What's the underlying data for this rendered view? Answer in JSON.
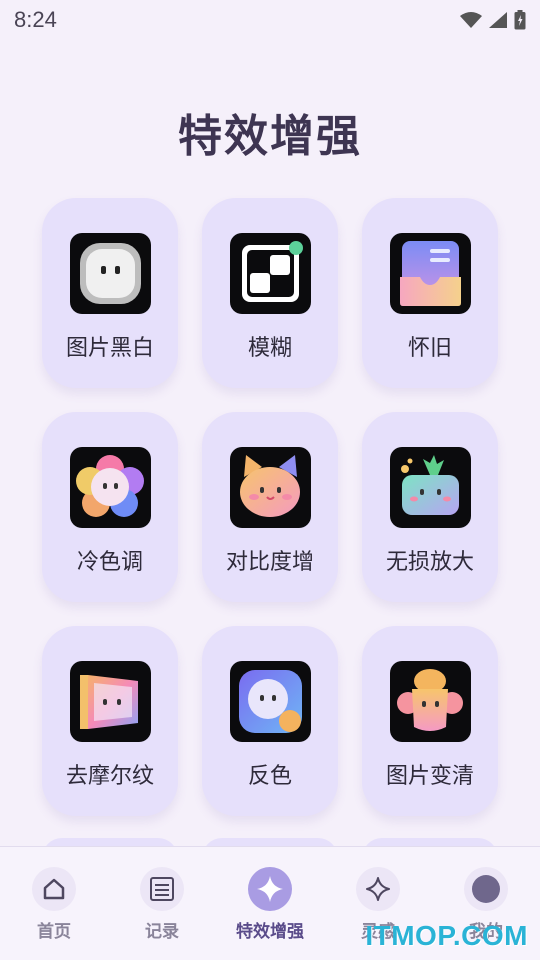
{
  "status_bar": {
    "time": "8:24"
  },
  "page": {
    "title": "特效增强"
  },
  "features": [
    {
      "label": "图片黑白",
      "icon": "blackwhite-icon"
    },
    {
      "label": "模糊",
      "icon": "blur-icon"
    },
    {
      "label": "怀旧",
      "icon": "nostalgia-icon"
    },
    {
      "label": "冷色调",
      "icon": "cool-tone-icon"
    },
    {
      "label": "对比度增",
      "icon": "contrast-icon"
    },
    {
      "label": "无损放大",
      "icon": "upscale-icon"
    },
    {
      "label": "去摩尔纹",
      "icon": "demoire-icon"
    },
    {
      "label": "反色",
      "icon": "invert-icon"
    },
    {
      "label": "图片变清",
      "icon": "sharpen-icon"
    }
  ],
  "tabs": [
    {
      "label": "首页",
      "icon": "home-icon",
      "active": false
    },
    {
      "label": "记录",
      "icon": "list-icon",
      "active": false
    },
    {
      "label": "特效增强",
      "icon": "sparkle-icon",
      "active": true
    },
    {
      "label": "灵感",
      "icon": "star-icon",
      "active": false
    },
    {
      "label": "我的",
      "icon": "profile-icon",
      "active": false
    }
  ],
  "watermark": "ITMOP.COM",
  "colors": {
    "accent": "#a99ce3",
    "card": "#e6e0fb",
    "background": "#f5f0fa",
    "watermark": "#2ab3d6"
  }
}
